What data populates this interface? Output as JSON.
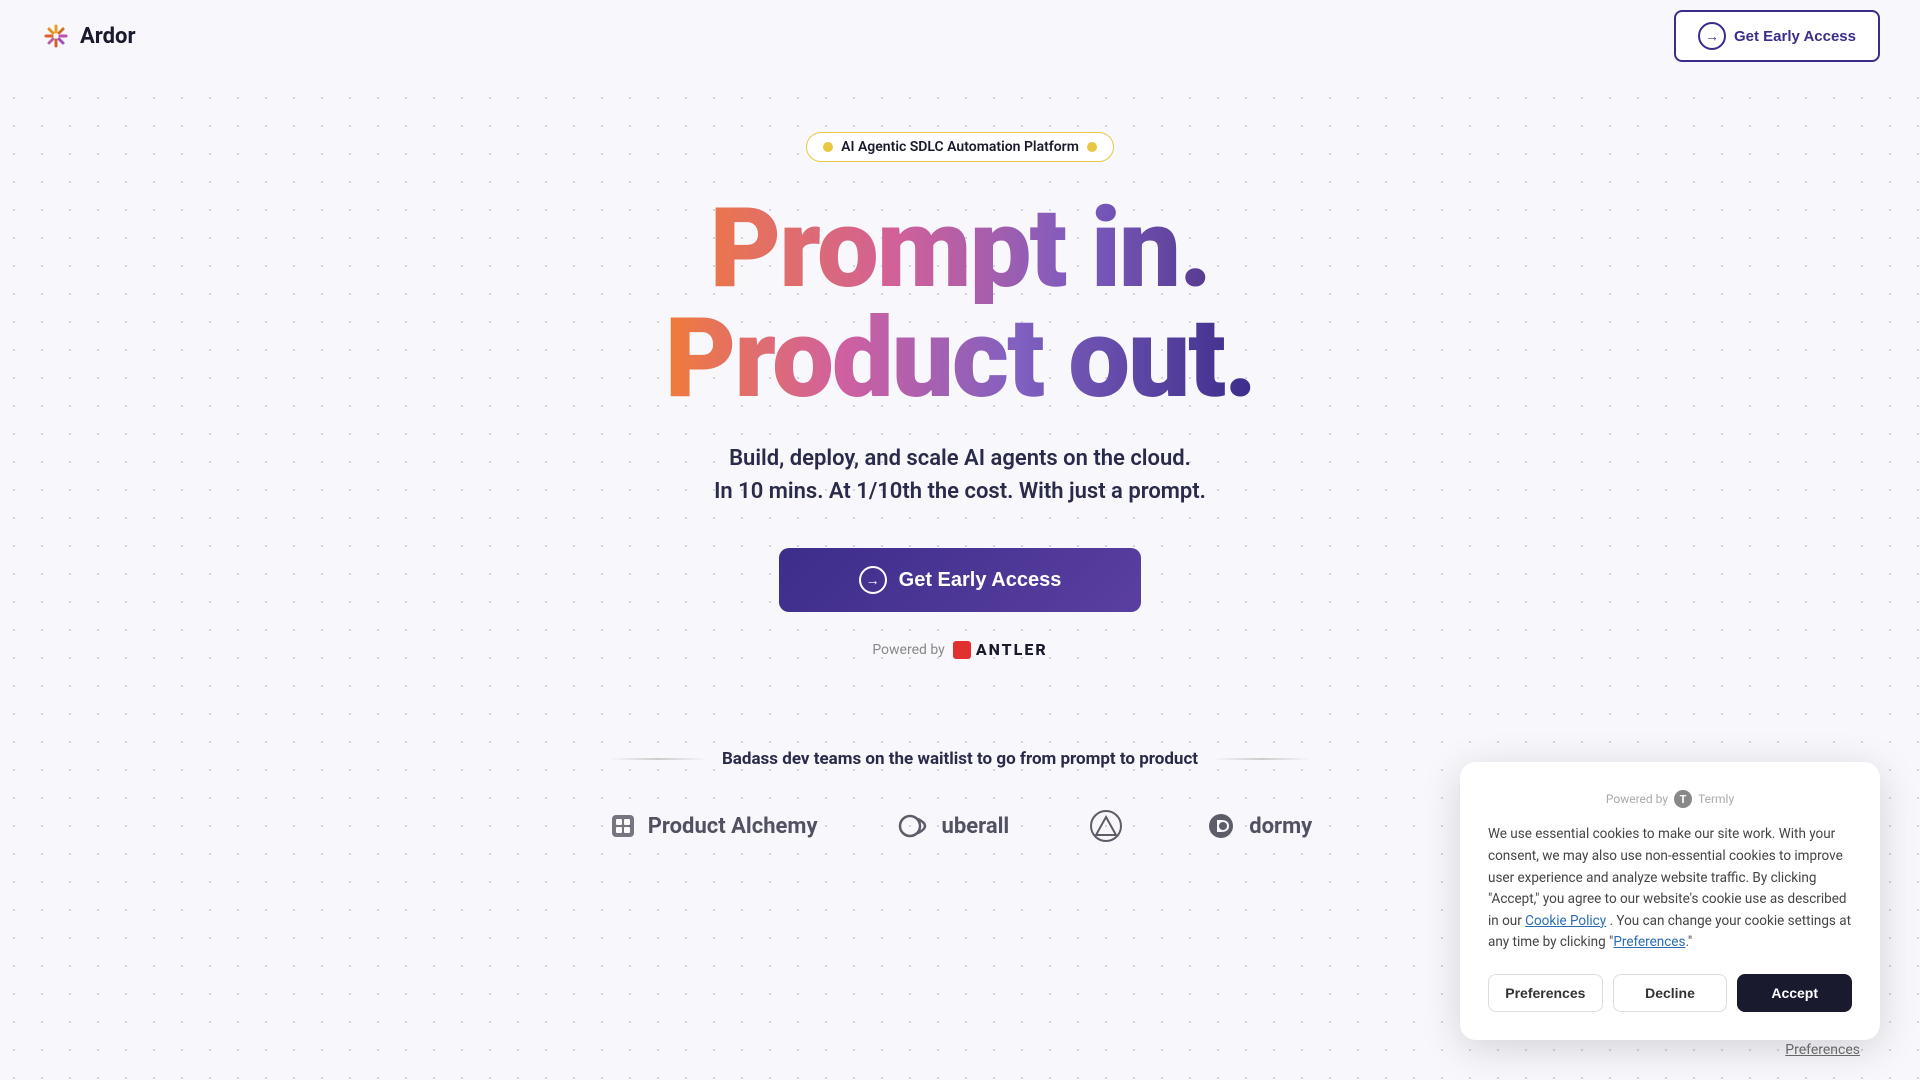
{
  "brand": {
    "name": "Ardor",
    "logo_icon_color": "#f0a030"
  },
  "navbar": {
    "cta_label": "Get Early Access",
    "cta_icon": "→"
  },
  "badge": {
    "text": "AI Agentic SDLC Automation Platform"
  },
  "hero": {
    "headline_line1": "Prompt in.",
    "headline_line2": "Product out.",
    "subline1": "Build, deploy, and scale AI agents on the cloud.",
    "subline2": "In 10 mins. At 1/10th the cost. With just a prompt.",
    "cta_label": "Get Early Access",
    "powered_by_label": "Powered by",
    "antler_label": "ANTLER"
  },
  "waitlist": {
    "text": "Badass dev teams on the waitlist to go from prompt to product"
  },
  "companies": [
    {
      "name": "Product Alchemy",
      "icon": "📦"
    },
    {
      "name": "uberall",
      "icon": "🔄"
    },
    {
      "name": "",
      "icon": "△"
    },
    {
      "name": "dormy",
      "icon": "🔵"
    }
  ],
  "cookie": {
    "powered_by": "Powered by",
    "termly_label": "Termly",
    "body": "We use essential cookies to make our site work. With your consent, we may also use non-essential cookies to improve user experience and analyze website traffic. By clicking \"Accept,\" you agree to our website's cookie use as described in our",
    "cookie_policy_link": "Cookie Policy",
    "body_suffix": ". You can change your cookie settings at any time by clicking \"",
    "preferences_link_text": "Preferences",
    "body_end": ".\"",
    "btn_preferences": "Preferences",
    "btn_decline": "Decline",
    "btn_accept": "Accept"
  },
  "footer": {
    "preferences_label": "Preferences"
  }
}
